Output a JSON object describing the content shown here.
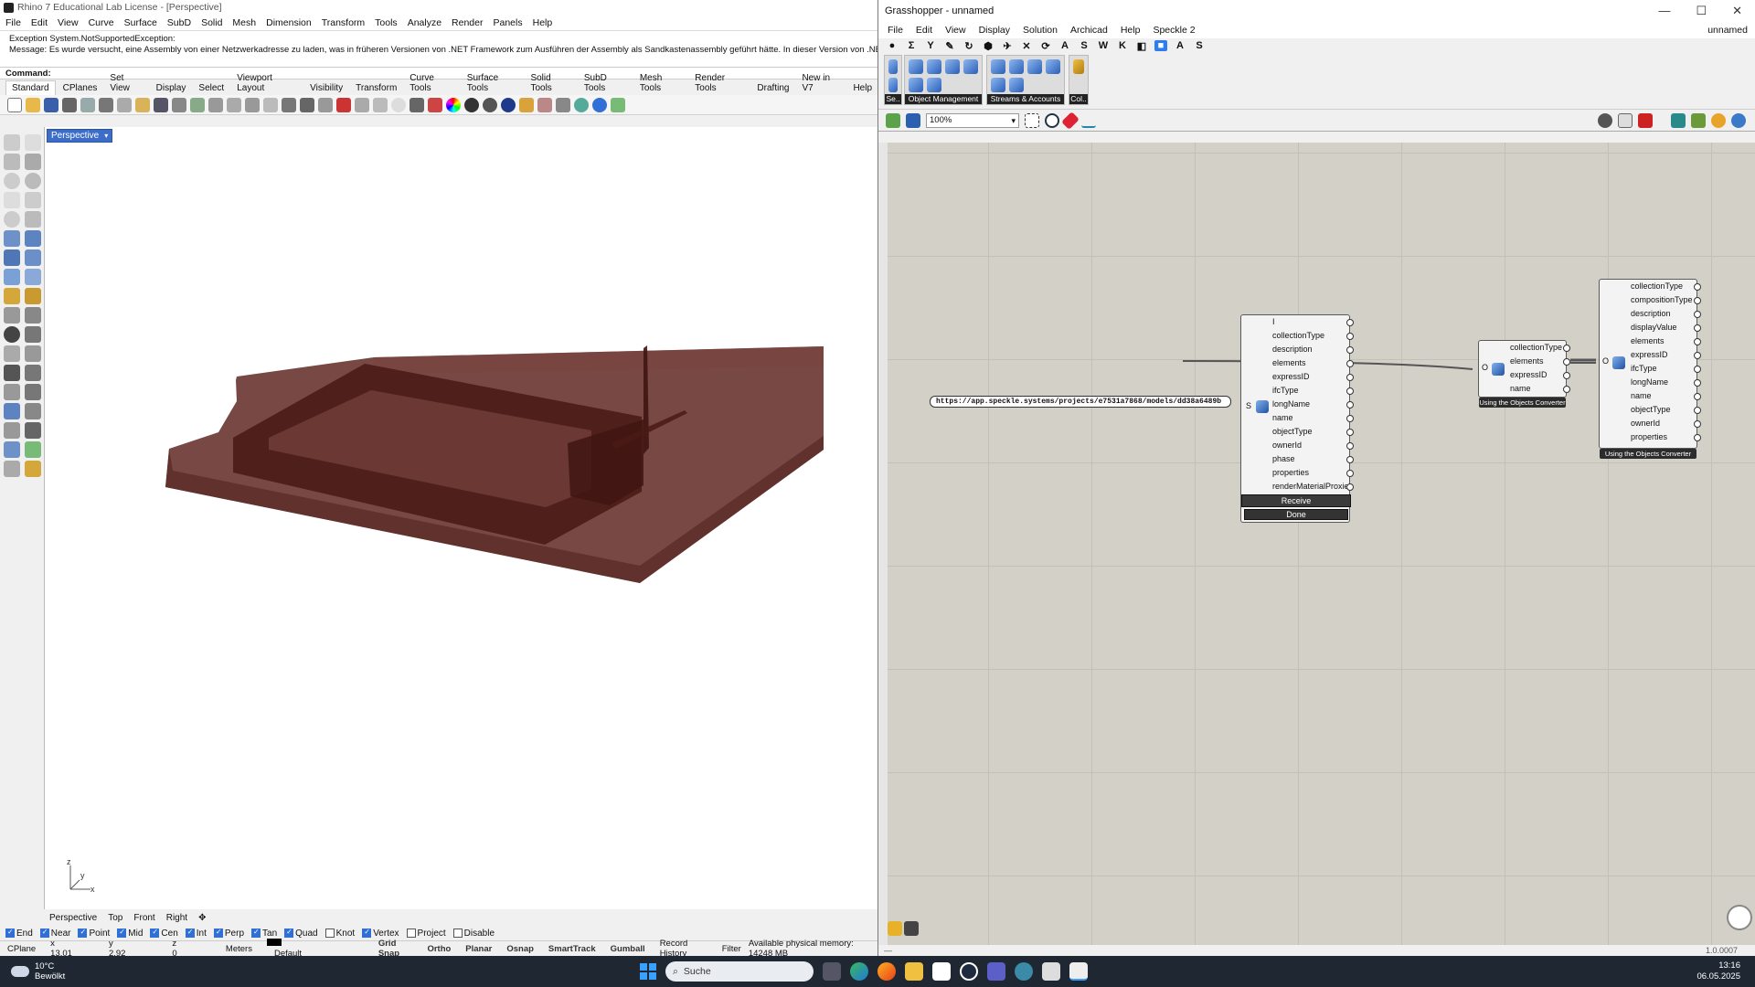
{
  "rhino": {
    "title": "Rhino 7 Educational Lab License - [Perspective]",
    "menu": [
      "File",
      "Edit",
      "View",
      "Curve",
      "Surface",
      "SubD",
      "Solid",
      "Mesh",
      "Dimension",
      "Transform",
      "Tools",
      "Analyze",
      "Render",
      "Panels",
      "Help"
    ],
    "history_line1": "Exception System.NotSupportedException:",
    "history_line2": "Message: Es wurde versucht, eine Assembly von einer Netzwerkadresse zu laden, was in früheren Versionen von .NET Framework zum Ausführen der Assembly als Sandkastenassembly geführt hätte. In dieser Version von .NET Framework wird",
    "command_label": "Command:",
    "toolbar_tabs": [
      "Standard",
      "CPlanes",
      "Set View",
      "Display",
      "Select",
      "Viewport Layout",
      "Visibility",
      "Transform",
      "Curve Tools",
      "Surface Tools",
      "Solid Tools",
      "SubD Tools",
      "Mesh Tools",
      "Render Tools",
      "Drafting",
      "New in V7",
      "Help"
    ],
    "viewport_label": "Perspective",
    "viewport_tabs": [
      "Perspective",
      "Top",
      "Front",
      "Right"
    ],
    "axis": {
      "z": "z",
      "y": "y",
      "x": "x"
    },
    "osnaps": [
      {
        "label": "End",
        "on": true
      },
      {
        "label": "Near",
        "on": true
      },
      {
        "label": "Point",
        "on": true
      },
      {
        "label": "Mid",
        "on": true
      },
      {
        "label": "Cen",
        "on": true
      },
      {
        "label": "Int",
        "on": true
      },
      {
        "label": "Perp",
        "on": true
      },
      {
        "label": "Tan",
        "on": true
      },
      {
        "label": "Quad",
        "on": true
      },
      {
        "label": "Knot",
        "on": false
      },
      {
        "label": "Vertex",
        "on": true
      },
      {
        "label": "Project",
        "on": false
      },
      {
        "label": "Disable",
        "on": false
      }
    ],
    "status": {
      "cplane": "CPlane",
      "x": "x 13.01",
      "y": "y 2.92",
      "z": "z 0",
      "units": "Meters",
      "layer": "Default",
      "toggles": [
        "Grid Snap",
        "Ortho",
        "Planar",
        "Osnap",
        "SmartTrack",
        "Gumball"
      ],
      "record": "Record History",
      "filter": "Filter",
      "memory": "Available physical memory: 14248 MB"
    }
  },
  "gh": {
    "title": "Grasshopper - unnamed",
    "window_controls": [
      "—",
      "☐",
      "✕"
    ],
    "menu": [
      "File",
      "Edit",
      "View",
      "Display",
      "Solution",
      "Archicad",
      "Help",
      "Speckle 2"
    ],
    "doc_name": "unnamed",
    "tab_icons": [
      "●",
      "Σ",
      "Y",
      "✎",
      "↻",
      "⬢",
      "✈",
      "✕",
      "⟳",
      "A",
      "S",
      "W",
      "K",
      "◧",
      "■",
      "A",
      "S"
    ],
    "ribbon_groups": [
      {
        "caption": "Se.."
      },
      {
        "caption": "Object Management"
      },
      {
        "caption": "Streams & Accounts"
      },
      {
        "caption": "Col.."
      }
    ],
    "zoom": "100%",
    "receive_component": {
      "outputs": [
        "I",
        "collectionType",
        "description",
        "elements",
        "expressID",
        "ifcType",
        "longName",
        "name",
        "objectType",
        "ownerId",
        "phase",
        "properties",
        "renderMaterialProxies"
      ],
      "input_label": "S",
      "button_receive": "Receive",
      "button_done": "Done"
    },
    "url": "https://app.speckle.systems/projects/e7531a7868/models/dd38a6489b",
    "expand1": {
      "outputs": [
        "collectionType",
        "elements",
        "expressID",
        "name"
      ],
      "input_label": "O",
      "caption": "Using the Objects Converter"
    },
    "expand2": {
      "outputs": [
        "collectionType",
        "compositionType",
        "description",
        "displayValue",
        "elements",
        "expressID",
        "ifcType",
        "longName",
        "name",
        "objectType",
        "ownerId",
        "properties"
      ],
      "input_label": "O",
      "caption": "Using the Objects Converter"
    },
    "version": "1.0.0007"
  },
  "taskbar": {
    "temp": "10°C",
    "weather": "Bewölkt",
    "search": "Suche",
    "time": "13:16",
    "date": "06.05.2025"
  },
  "colors": {
    "model_fill": "#6d3a36",
    "model_dark": "#3f1512",
    "gh_canvas": "#d3d0c8",
    "accent": "#2d7cf0"
  }
}
